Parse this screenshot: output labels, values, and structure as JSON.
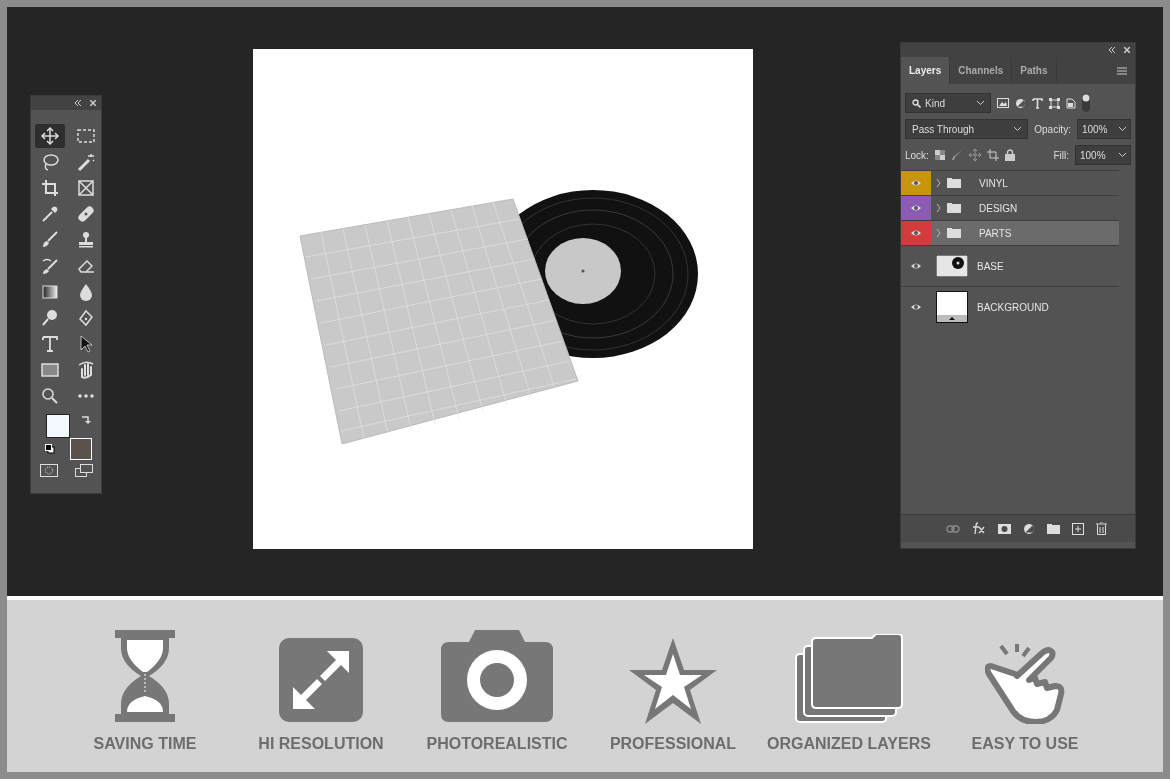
{
  "toolbar": {
    "tools": [
      {
        "selected": true
      },
      {
        "selected": false
      },
      {
        "selected": false
      },
      {
        "selected": false
      },
      {
        "selected": false
      },
      {
        "selected": false
      },
      {
        "selected": false
      },
      {
        "selected": false
      },
      {
        "selected": false
      },
      {
        "selected": false
      },
      {
        "selected": false
      },
      {
        "selected": false
      },
      {
        "selected": false
      },
      {
        "selected": false
      },
      {
        "selected": false
      },
      {
        "selected": false
      },
      {
        "selected": false
      },
      {
        "selected": false
      },
      {
        "selected": false
      },
      {
        "selected": false
      },
      {
        "selected": false
      },
      {
        "selected": false
      }
    ]
  },
  "layers_panel": {
    "tabs": [
      {
        "label": "Layers",
        "selected": true
      },
      {
        "label": "Channels",
        "selected": false
      },
      {
        "label": "Paths",
        "selected": false
      }
    ],
    "filter": "Kind",
    "blend_mode": "Pass Through",
    "opacity_label": "Opacity:",
    "opacity": "100%",
    "lock_label": "Lock:",
    "fill_label": "Fill:",
    "fill": "100%",
    "layers": [
      {
        "name": "VINYL",
        "kind": "group",
        "color": "#c8960c",
        "selected": false
      },
      {
        "name": "DESIGN",
        "kind": "group",
        "color": "#8a5cb4",
        "selected": false
      },
      {
        "name": "PARTS",
        "kind": "group",
        "color": "#d23c3c",
        "selected": true
      },
      {
        "name": "BASE",
        "kind": "base",
        "selected": false
      },
      {
        "name": "BACKGROUND",
        "kind": "background",
        "selected": false
      }
    ]
  },
  "features": [
    {
      "label": "SAVING TIME"
    },
    {
      "label": "HI RESOLUTION"
    },
    {
      "label": "PHOTOREALISTIC"
    },
    {
      "label": "PROFESSIONAL"
    },
    {
      "label": "ORGANIZED LAYERS"
    },
    {
      "label": "EASY TO USE"
    }
  ]
}
